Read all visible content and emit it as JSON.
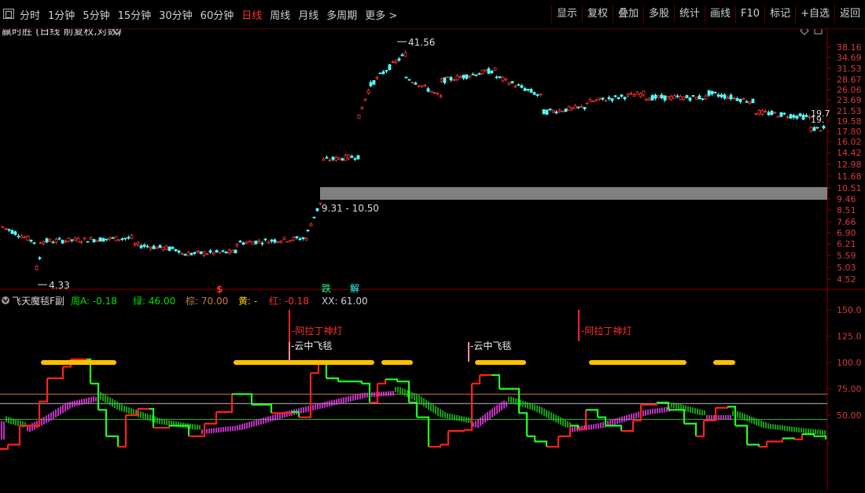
{
  "toolbar": {
    "periods": [
      "分时",
      "1分钟",
      "5分钟",
      "15分钟",
      "30分钟",
      "60分钟",
      "日线",
      "周线",
      "月线",
      "多周期",
      "更多 >"
    ],
    "active_period": "日线",
    "tools": [
      "显示",
      "复权",
      "叠加",
      "多股",
      "统计",
      "画线",
      "F10",
      "标记",
      "+自选",
      "返回"
    ]
  },
  "main_chart": {
    "title": "赢时胜 (日线 前复权,对数)",
    "y_ticks": [
      "38.16",
      "34.69",
      "31.53",
      "28.67",
      "26.06",
      "23.69",
      "21.53",
      "19.58",
      "17.80",
      "16.02",
      "14.42",
      "12.98",
      "11.68",
      "10.51",
      "9.46",
      "8.51",
      "7.66",
      "6.90",
      "6.21",
      "5.59",
      "5.03",
      "4.52"
    ],
    "high_label": "41.56",
    "low_label": "4.33",
    "gap_label": "9.31 - 10.50",
    "right_edge_label_1": "19.7",
    "right_edge_label_2": "19.",
    "markers": [
      "$",
      "跌",
      "解"
    ],
    "colors": {
      "up": "#ff3232",
      "down": "#54ffff",
      "gap_band": "#808080",
      "grid": "#8b0000"
    }
  },
  "indicator": {
    "name": "飞天魔毯F副",
    "items": [
      {
        "label": "周A:",
        "value": "-0.18",
        "color": "#00e000"
      },
      {
        "label": "绿:",
        "value": "46.00",
        "color": "#00e000"
      },
      {
        "label": "棕:",
        "value": "70.00",
        "color": "#c08040"
      },
      {
        "label": "黄:",
        "value": "-",
        "color": "#ffd000"
      },
      {
        "label": "红:",
        "value": "-0.18",
        "color": "#ff3030"
      },
      {
        "label": "XX:",
        "value": "61.00",
        "color": "#d0d0d0"
      }
    ],
    "y_ticks": [
      "150.0",
      "125.0",
      "100.0",
      "75.00",
      "50.00"
    ],
    "annotations": [
      "阿拉丁神灯",
      "云中飞毯",
      "云中飞毯",
      "阿拉丁神灯"
    ],
    "colors": {
      "red_line": "#ff2020",
      "green_line": "#20ff20",
      "magenta": "#ff40ff",
      "cloud_green": "#20d020",
      "yellow": "#ffc000"
    }
  }
}
